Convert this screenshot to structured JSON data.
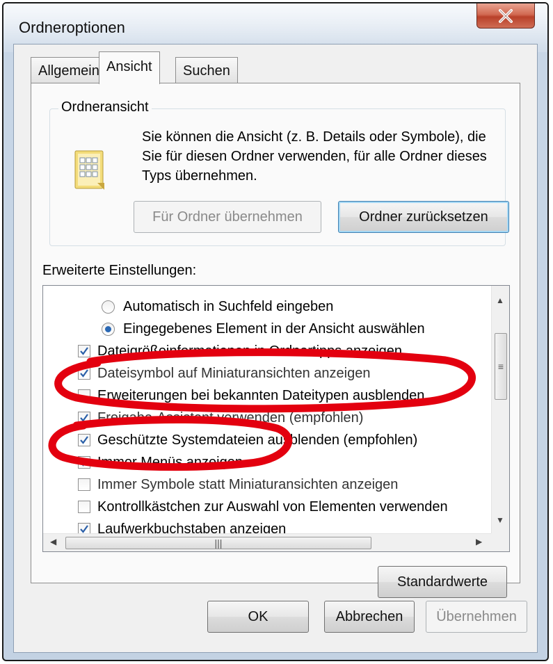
{
  "window": {
    "title": "Ordneroptionen"
  },
  "tabs": [
    {
      "label": "Allgemein"
    },
    {
      "label": "Ansicht"
    },
    {
      "label": "Suchen"
    }
  ],
  "folder_view": {
    "legend": "Ordneransicht",
    "description": "Sie können die Ansicht (z. B. Details oder Symbole), die Sie für diesen Ordner verwenden, für alle Ordner dieses Typs übernehmen.",
    "apply_button": "Für Ordner übernehmen",
    "reset_button": "Ordner zurücksetzen"
  },
  "advanced": {
    "label": "Erweiterte Einstellungen:",
    "items": [
      {
        "type": "radio",
        "checked": false,
        "label": "Automatisch in Suchfeld eingeben"
      },
      {
        "type": "radio",
        "checked": true,
        "label": "Eingegebenes Element in der Ansicht auswählen"
      },
      {
        "type": "checkbox",
        "checked": true,
        "label": "Dateigrößeinformationen in Ordnertipps anzeigen"
      },
      {
        "type": "checkbox",
        "checked": true,
        "label": "Dateisymbol auf Miniaturansichten anzeigen"
      },
      {
        "type": "checkbox",
        "checked": false,
        "label": "Erweiterungen bei bekannten Dateitypen ausblenden"
      },
      {
        "type": "checkbox",
        "checked": true,
        "label": "Freigabe-Assistent verwenden (empfohlen)"
      },
      {
        "type": "checkbox",
        "checked": true,
        "label": "Geschützte Systemdateien ausblenden (empfohlen)"
      },
      {
        "type": "checkbox",
        "checked": true,
        "label": "Immer Menüs anzeigen"
      },
      {
        "type": "checkbox",
        "checked": false,
        "label": "Immer Symbole statt Miniaturansichten anzeigen"
      },
      {
        "type": "checkbox",
        "checked": false,
        "label": "Kontrollkästchen zur Auswahl von Elementen verwenden"
      },
      {
        "type": "checkbox",
        "checked": true,
        "label": "Laufwerkbuchstaben anzeigen"
      }
    ],
    "defaults_button": "Standardwerte"
  },
  "footer": {
    "ok": "OK",
    "cancel": "Abbrechen",
    "apply": "Übernehmen"
  },
  "icons": {
    "close": "close-icon",
    "folder_view": "folder-view-icon",
    "scroll_up": "scroll-up-arrow-icon",
    "scroll_down": "scroll-down-arrow-icon",
    "scroll_left": "scroll-left-arrow-icon",
    "scroll_right": "scroll-right-arrow-icon"
  },
  "colors": {
    "marker": "#e3000f",
    "checkmark": "#2a5fa8"
  }
}
